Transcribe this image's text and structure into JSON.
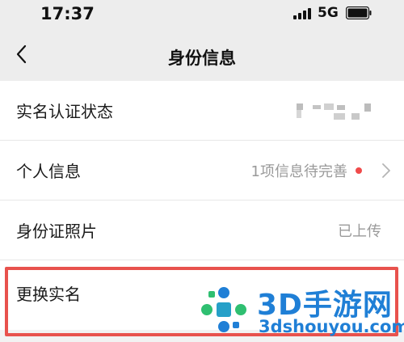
{
  "status_bar": {
    "time": "17:37",
    "network": "5G",
    "signal_icon": "signal-bars-icon",
    "battery_icon": "battery-icon"
  },
  "nav": {
    "title": "身份信息",
    "back_icon": "chevron-left-icon"
  },
  "rows": [
    {
      "label": "实名认证状态",
      "value": ""
    },
    {
      "label": "个人信息",
      "value": "1项信息待完善"
    },
    {
      "label": "身份证照片",
      "value": "已上传"
    },
    {
      "label": "更换实名",
      "value": ""
    }
  ],
  "watermark": {
    "brand": "3D手游网",
    "domain": "3dshouyou.com"
  },
  "colors": {
    "accent_red": "#e8524d",
    "dot_red": "#f04a4a",
    "watermark_blue": "#1f7fd6",
    "watermark_green": "#2fbf71"
  }
}
